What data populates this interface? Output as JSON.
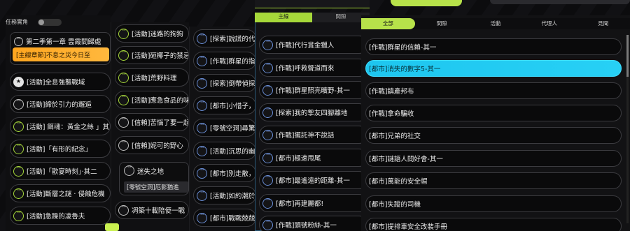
{
  "panel_a": {
    "toggle_label": "任務實角",
    "chapter": {
      "title": "第二季第一章 雲霞間歸處",
      "subtitle": "[主線章節]不息之災今日至"
    },
    "items": [
      "[活動]全息強襲戰域",
      "[活動]締於引力的邂逅",
      "[活動] 餌魂：黃金之絲 」其三",
      "[活動]「有形的紀念」",
      "[活動]「歡宴時刻」·其二",
      "[活動]斷層之謎 · 侵蝕危機",
      "[活動]急躁的凌魯夫"
    ]
  },
  "panel_b": {
    "items": [
      "[活動]迷路的狗狗",
      "[活動]砸椰子的禁忌",
      "[活動]荒野料理",
      "[活動]應急食品的味道",
      "[信賴]苦惱了要一起的",
      "[信賴]妮可的野心"
    ],
    "card": {
      "title": "迷失之地",
      "sub": "[零號空洞]厄影猶進"
    },
    "last_item": "凋築十載陪便一戰"
  },
  "panel_c": {
    "items": [
      "[探索]說謊的代價",
      "[作戰]群星的指引",
      "[探索]倒帶偵探",
      "[都市]小惜子，大",
      "[零號空洞]尋驚",
      "[活動]沉思的幽影",
      "[都市]別走散，在",
      "[活動]如約潮於海",
      "[都市]戰戰兢兢的"
    ]
  },
  "panel_d": {
    "tabs": [
      "主線",
      "間隙"
    ],
    "items": [
      "[作戰]代行賞金獵人",
      "[作戰]呼救聲道而來",
      "[作戰]群星照亮曠野-其一",
      "[探索]我的摯友四腳離地",
      "[作戰]擺託神不說話",
      "[都市]極速甩尾",
      "[都市]最遙遠的距離-其一",
      "[都市]再建麗都!",
      "[作戰]頭號粉絲-其一"
    ]
  },
  "panel_e": {
    "tabs": [
      "全部",
      "間隙",
      "活動",
      "代理人",
      "見聞"
    ],
    "items": [
      "[作戰]群星的信賴-其一",
      "[都市]消失的數字5-其一",
      "[作戰]鎮產邦布",
      "[作戰]拿命騙收",
      "[都市]兄弟的社交",
      "[都市]謎語人間好會-其一",
      "[都市]萬能的安全帽",
      "[都市]失蹤的司機",
      "[都市]提排車安全改裝手冊"
    ]
  },
  "colors": {
    "accent_green": "#a6d83a",
    "highlight_cyan": "#1ec6ef",
    "chapter_orange": "#ffa51f"
  }
}
